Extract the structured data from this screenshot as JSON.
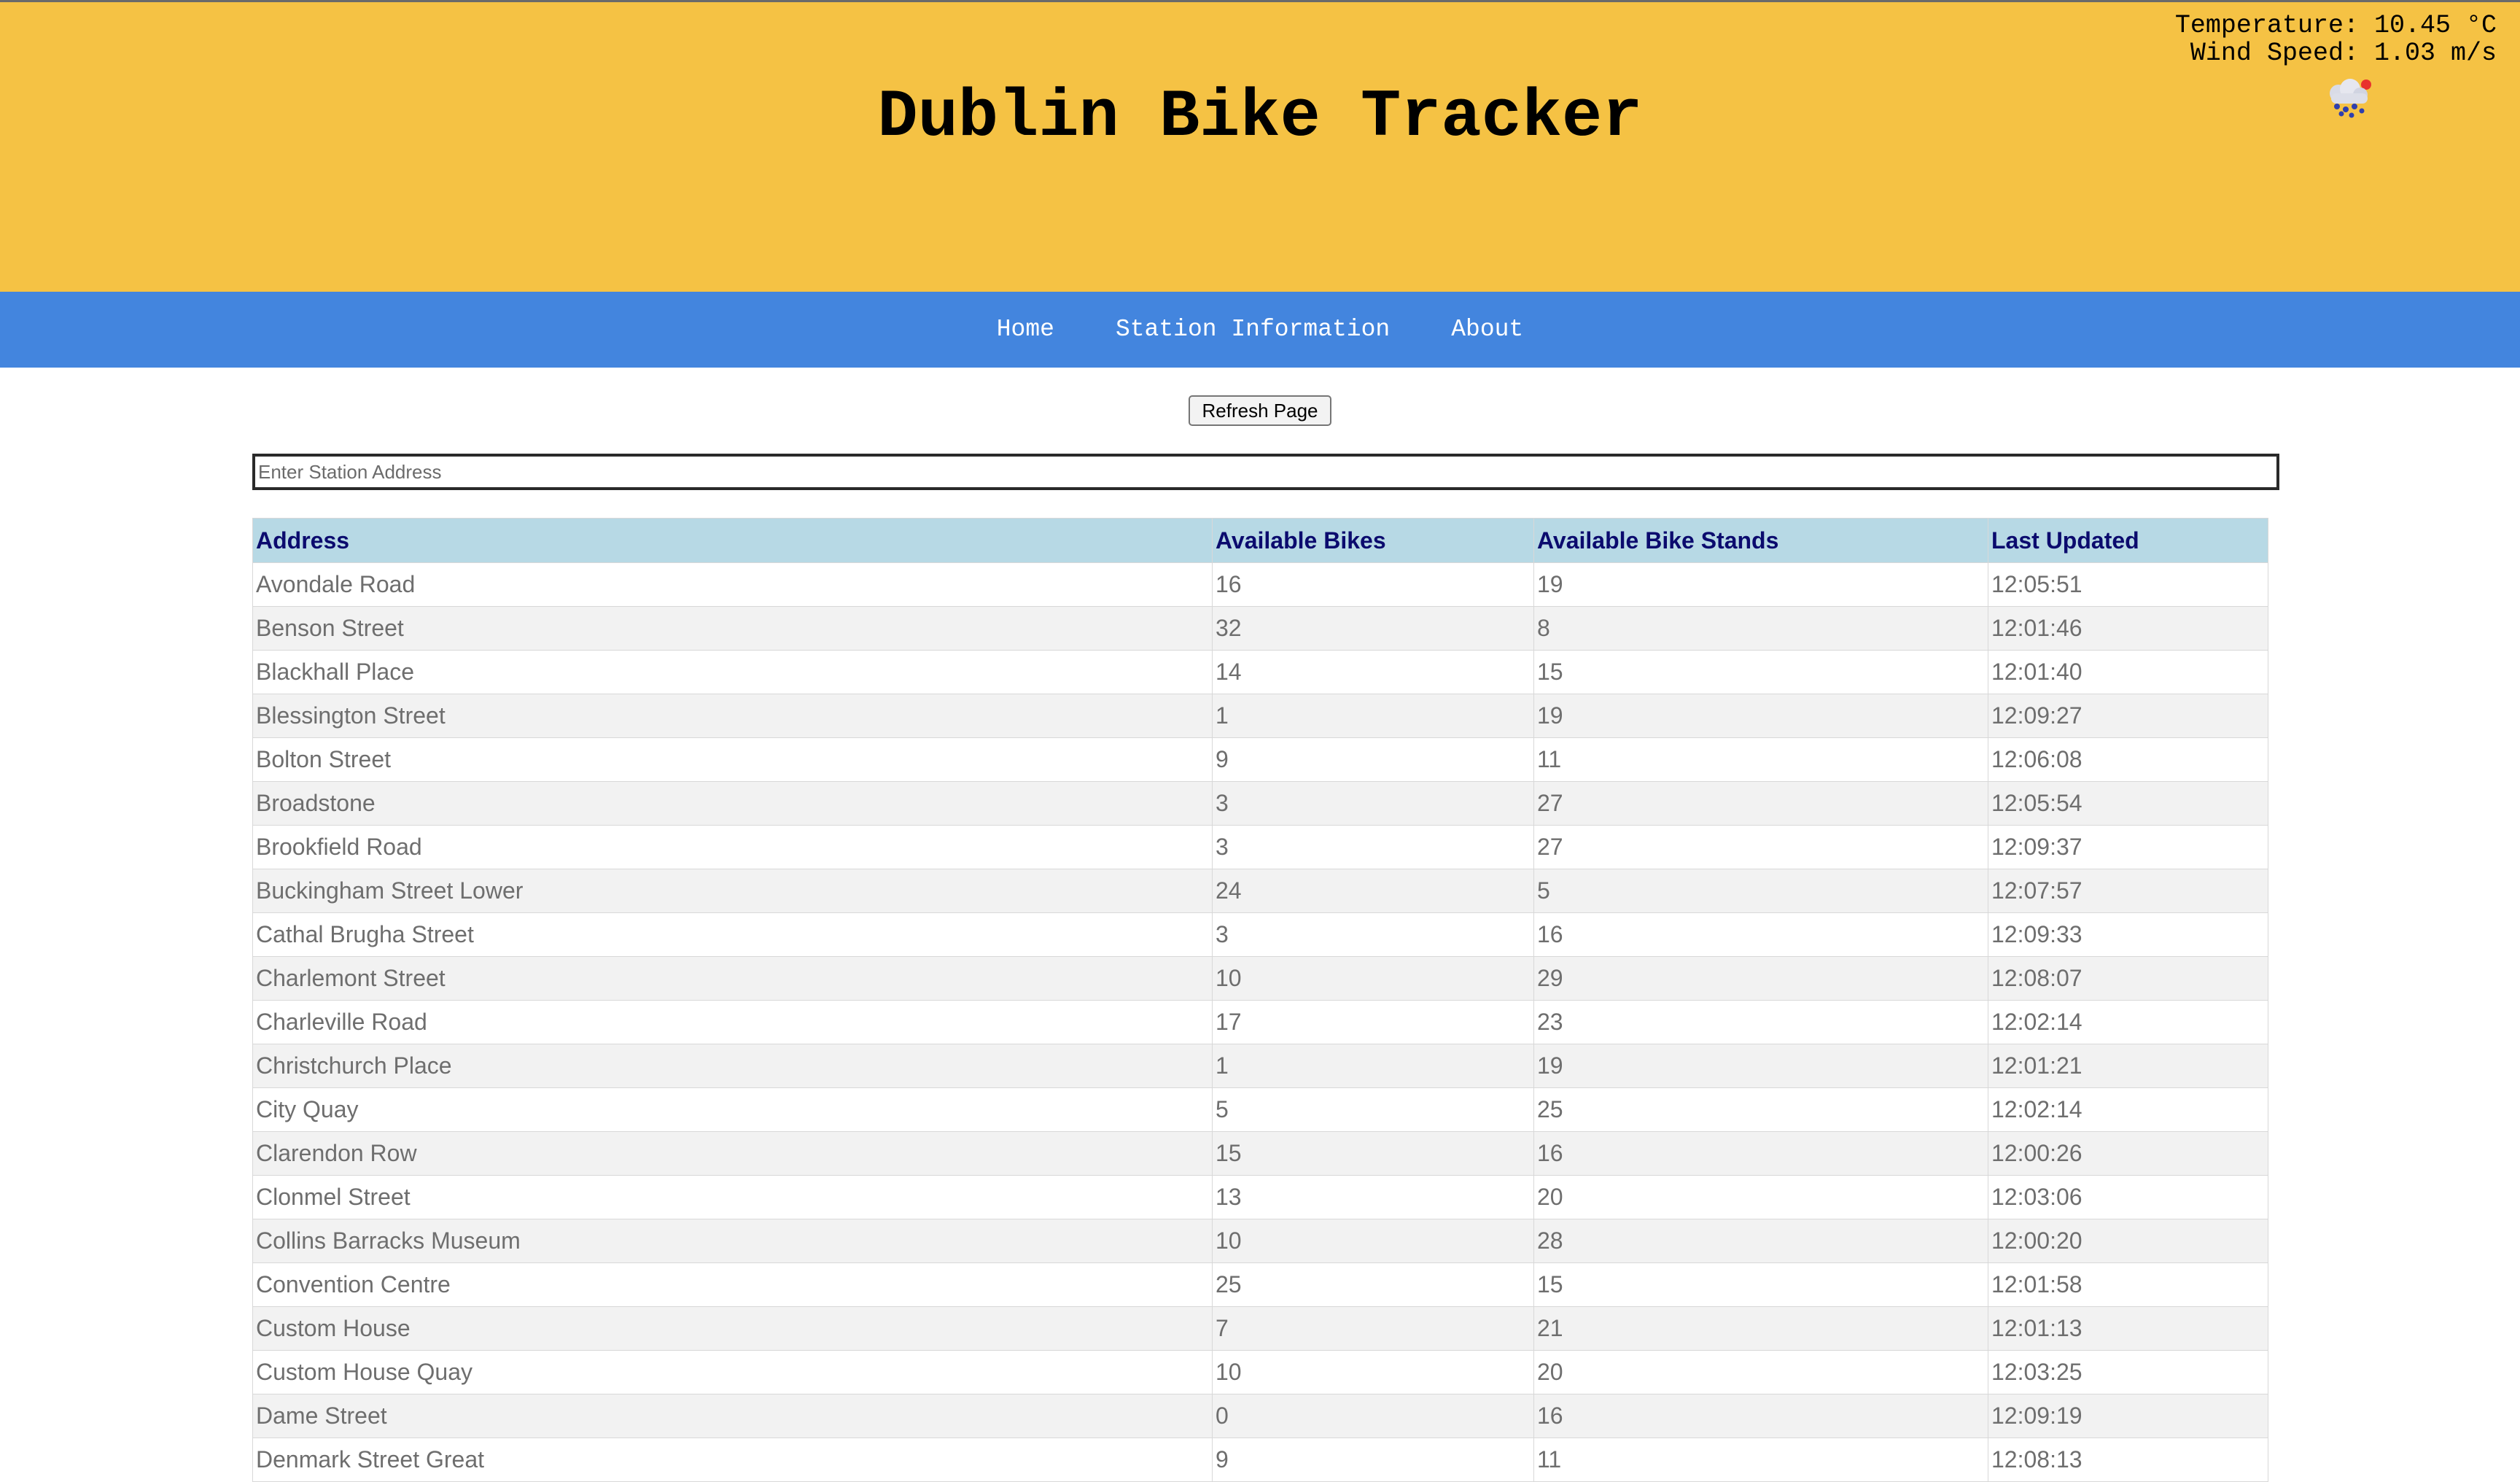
{
  "header": {
    "title": "Dublin Bike Tracker",
    "background_color": "#f5c244"
  },
  "weather": {
    "temperature": "Temperature: 10.45 °C",
    "wind_speed": "Wind Speed: 1.03 m/s",
    "icon": "rain-cloud-icon"
  },
  "nav": {
    "background_color": "#4385de",
    "items": [
      {
        "label": "Home"
      },
      {
        "label": "Station Information"
      },
      {
        "label": "About"
      }
    ]
  },
  "refresh": {
    "label": "Refresh Page"
  },
  "search": {
    "placeholder": "Enter Station Address",
    "value": ""
  },
  "table": {
    "header_color": "#b7d9e5",
    "columns": [
      "Address",
      "Available Bikes",
      "Available Bike Stands",
      "Last Updated"
    ],
    "rows": [
      [
        "Avondale Road",
        "16",
        "19",
        "12:05:51"
      ],
      [
        "Benson Street",
        "32",
        "8",
        "12:01:46"
      ],
      [
        "Blackhall Place",
        "14",
        "15",
        "12:01:40"
      ],
      [
        "Blessington Street",
        "1",
        "19",
        "12:09:27"
      ],
      [
        "Bolton Street",
        "9",
        "11",
        "12:06:08"
      ],
      [
        "Broadstone",
        "3",
        "27",
        "12:05:54"
      ],
      [
        "Brookfield Road",
        "3",
        "27",
        "12:09:37"
      ],
      [
        "Buckingham Street Lower",
        "24",
        "5",
        "12:07:57"
      ],
      [
        "Cathal Brugha Street",
        "3",
        "16",
        "12:09:33"
      ],
      [
        "Charlemont Street",
        "10",
        "29",
        "12:08:07"
      ],
      [
        "Charleville Road",
        "17",
        "23",
        "12:02:14"
      ],
      [
        "Christchurch Place",
        "1",
        "19",
        "12:01:21"
      ],
      [
        "City Quay",
        "5",
        "25",
        "12:02:14"
      ],
      [
        "Clarendon Row",
        "15",
        "16",
        "12:00:26"
      ],
      [
        "Clonmel Street",
        "13",
        "20",
        "12:03:06"
      ],
      [
        "Collins Barracks Museum",
        "10",
        "28",
        "12:00:20"
      ],
      [
        "Convention Centre",
        "25",
        "15",
        "12:01:58"
      ],
      [
        "Custom House",
        "7",
        "21",
        "12:01:13"
      ],
      [
        "Custom House Quay",
        "10",
        "20",
        "12:03:25"
      ],
      [
        "Dame Street",
        "0",
        "16",
        "12:09:19"
      ],
      [
        "Denmark Street Great",
        "9",
        "11",
        "12:08:13"
      ]
    ]
  }
}
